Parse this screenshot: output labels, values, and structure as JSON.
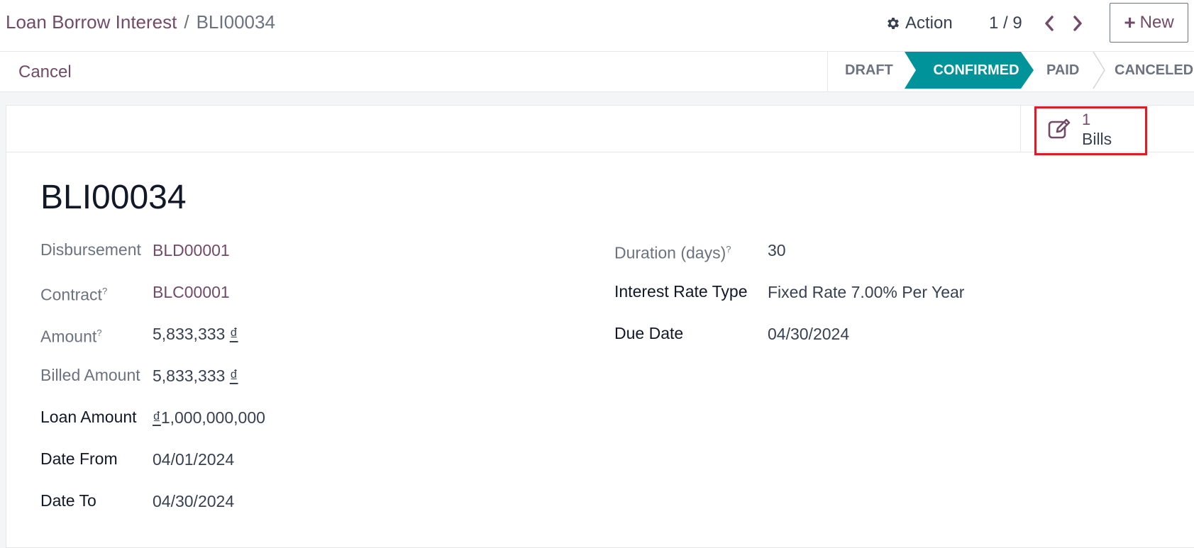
{
  "breadcrumb": {
    "parent": "Loan Borrow Interest",
    "separator": "/",
    "current": "BLI00034"
  },
  "toolbar": {
    "action_label": "Action",
    "pager": "1 / 9",
    "new_label": "New"
  },
  "status_row": {
    "cancel_label": "Cancel",
    "stages": [
      "DRAFT",
      "CONFIRMED",
      "PAID",
      "CANCELED"
    ],
    "active_stage": "CONFIRMED",
    "active_color": "#00939a"
  },
  "smart_button": {
    "count": "1",
    "label": "Bills"
  },
  "record": {
    "name": "BLI00034"
  },
  "fields_left": {
    "disbursement_label": "Disbursement",
    "disbursement_value": "BLD00001",
    "contract_label": "Contract",
    "contract_help": "?",
    "contract_value": "BLC00001",
    "amount_label": "Amount",
    "amount_help": "?",
    "amount_value": "5,833,333",
    "amount_currency": "₫",
    "billed_amount_label": "Billed Amount",
    "billed_amount_value": "5,833,333",
    "billed_amount_currency": "₫",
    "loan_amount_label": "Loan Amount",
    "loan_amount_currency": "₫",
    "loan_amount_value": "1,000,000,000",
    "date_from_label": "Date From",
    "date_from_value": "04/01/2024",
    "date_to_label": "Date To",
    "date_to_value": "04/30/2024"
  },
  "fields_right": {
    "duration_label": "Duration (days)",
    "duration_help": "?",
    "duration_value": "30",
    "interest_rate_type_label": "Interest Rate Type",
    "interest_rate_type_value": "Fixed Rate 7.00% Per Year",
    "due_date_label": "Due Date",
    "due_date_value": "04/30/2024"
  },
  "colors": {
    "brand": "#714b67",
    "active_stage": "#00939a",
    "highlight": "#e01b24"
  }
}
